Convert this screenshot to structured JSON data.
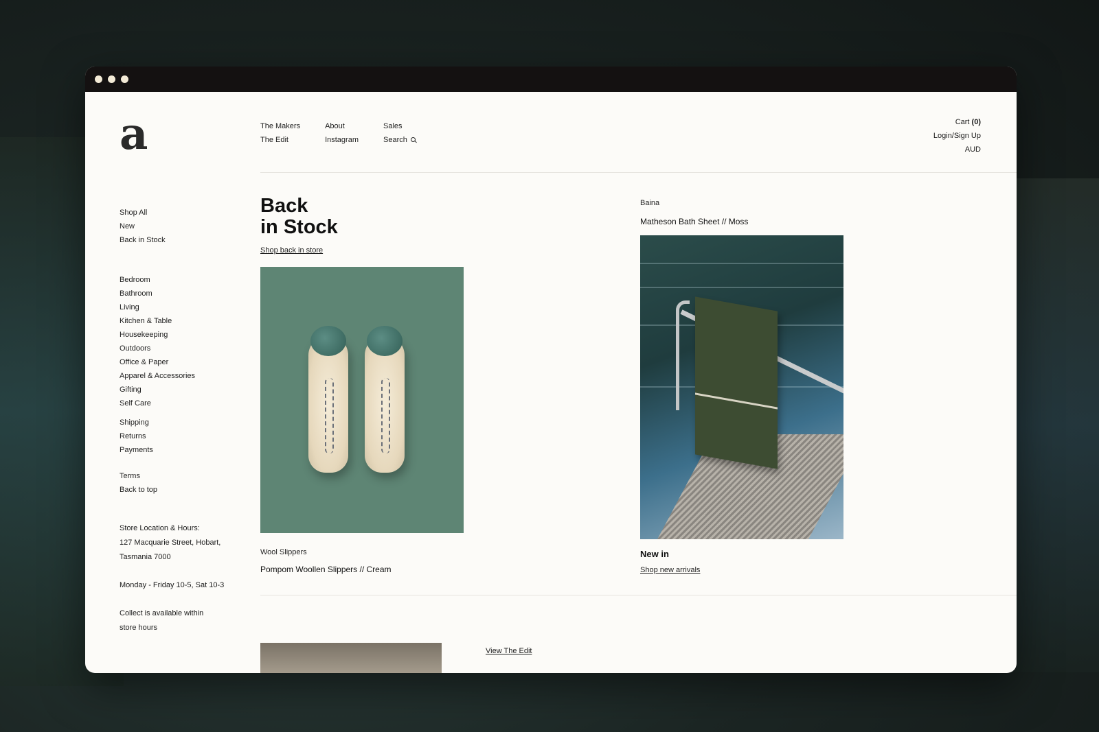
{
  "brand": {
    "logo": "a"
  },
  "nav": {
    "col1": [
      "The Makers",
      "The Edit"
    ],
    "col2": [
      "About",
      "Instagram"
    ],
    "col3": [
      "Sales",
      "Search"
    ]
  },
  "account": {
    "cart_label": "Cart ",
    "cart_count": "(0)",
    "login": "Login/Sign Up",
    "currency": "AUD"
  },
  "sidebar": {
    "primary": [
      "Shop All",
      "New",
      "Back in Stock"
    ],
    "categories": [
      "Bedroom",
      "Bathroom",
      "Living",
      "Kitchen & Table",
      "Housekeeping",
      "Outdoors",
      "Office & Paper",
      "Apparel & Accessories",
      "Gifting",
      "Self Care"
    ],
    "info": [
      "Shipping",
      "Returns",
      "Payments"
    ],
    "legal": [
      "Terms",
      "Back to top"
    ],
    "store": {
      "heading": "Store Location & Hours:",
      "address1": "127 Macquarie Street, Hobart,",
      "address2": "Tasmania 7000",
      "hours": "Monday - Friday 10-5, Sat 10-3",
      "collect1": "Collect is available within",
      "collect2": "store hours"
    }
  },
  "hero": {
    "title_line1": "Back",
    "title_line2": "in Stock",
    "link": "Shop back in store"
  },
  "product1": {
    "maker": "Wool Slippers",
    "name": "Pompom Woollen Slippers // Cream"
  },
  "product2": {
    "maker": "Baina",
    "name": "Matheson Bath Sheet // Moss"
  },
  "new_in": {
    "title": "New in",
    "link": "Shop new arrivals"
  },
  "edit": {
    "link": "View The Edit"
  },
  "colors": {
    "background": "#fcfbf8",
    "titlebar": "#141111",
    "slipper_bg": "#5e8574"
  }
}
